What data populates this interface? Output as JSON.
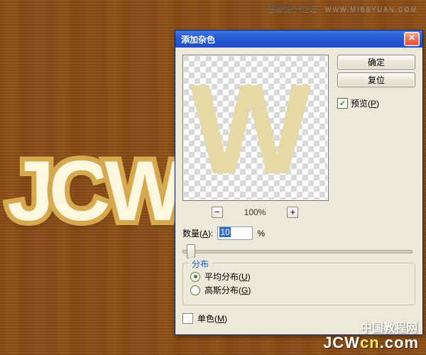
{
  "brand": {
    "name": "思缘设计论坛",
    "url": "WWW.MISSYUAN.COM"
  },
  "canvas_text": "JCW",
  "dialog": {
    "title": "添加杂色",
    "close_glyph": "✕",
    "ok": "确定",
    "cancel": "复位",
    "preview_checkbox": "预览",
    "preview_hotkey": "P",
    "preview_letter": "W",
    "zoom": {
      "minus": "−",
      "plus": "+",
      "value": "100%"
    },
    "amount": {
      "label": "数量",
      "hotkey": "A",
      "value": "10",
      "suffix": "%"
    },
    "distribution": {
      "legend": "分布",
      "uniform": "平均分布",
      "uniform_hotkey": "U",
      "gaussian": "高斯分布",
      "gaussian_hotkey": "G",
      "selected": "uniform"
    },
    "mono": {
      "label": "单色",
      "hotkey": "M",
      "checked": false
    }
  },
  "watermark": {
    "line1": "中国教程网",
    "line2_a": "JCW",
    "line2_b": "cn",
    "line2_c": ".com"
  }
}
